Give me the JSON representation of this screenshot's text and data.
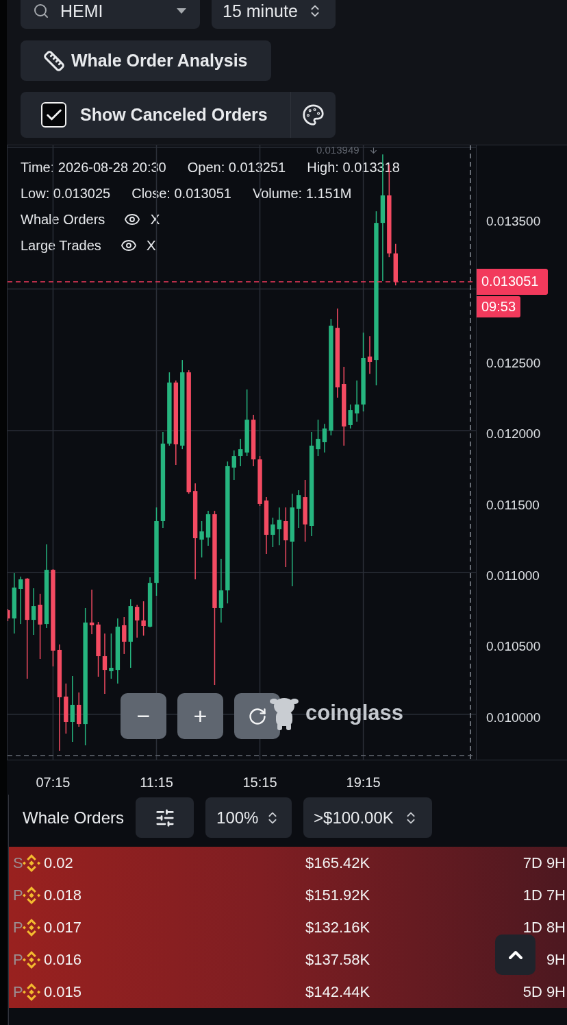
{
  "symbol_select": {
    "value": "HEMI"
  },
  "interval_select": {
    "value": "15 minute"
  },
  "analysis_button": {
    "label": "Whale Order Analysis"
  },
  "canceled_toggle": {
    "label": "Show Canceled Orders",
    "checked": true
  },
  "chart": {
    "high_marker": "0.013949",
    "ohlc_rows": [
      [
        "Time: 2026-08-28 20:30",
        "Open: 0.013251",
        "High: 0.013318"
      ],
      [
        "Low: 0.013025",
        "Close: 0.013051",
        "Volume: 1.151M"
      ]
    ],
    "layers": [
      {
        "name": "Whale Orders",
        "visible": true,
        "remove": "X"
      },
      {
        "name": "Large Trades",
        "visible": true,
        "remove": "X"
      }
    ],
    "current_price": {
      "price": "0.013051",
      "countdown": "09:53"
    },
    "zoom_controls": {
      "zoom_out": "−",
      "zoom_in": "+"
    },
    "logo_text": "coinglass",
    "chart_data": {
      "type": "candlestick",
      "grid": true,
      "x": [
        5.5,
        5.75,
        6,
        6.25,
        6.5,
        6.75,
        7,
        7.25,
        7.5,
        7.75,
        8,
        8.25,
        8.5,
        8.75,
        9,
        9.25,
        9.5,
        9.75,
        10,
        10.25,
        10.5,
        10.75,
        11,
        11.25,
        11.5,
        11.75,
        12,
        12.25,
        12.5,
        12.75,
        13,
        13.25,
        13.5,
        13.75,
        14,
        14.25,
        14.5,
        14.75,
        15,
        15.25,
        15.5,
        15.75,
        16,
        16.25,
        16.5,
        16.75,
        17,
        17.25,
        17.5,
        17.75,
        18,
        18.25,
        18.5,
        18.75,
        19,
        19.25,
        19.5,
        19.75,
        20,
        20.25,
        20.5
      ],
      "ohlc": [
        [
          0.010734,
          0.010744,
          0.010657,
          0.010676
        ],
        [
          0.010676,
          0.010995,
          0.01057,
          0.010894
        ],
        [
          0.010884,
          0.010971,
          0.010637,
          0.010952
        ],
        [
          0.010957,
          0.010961,
          0.010251,
          0.010666
        ],
        [
          0.010666,
          0.010889,
          0.01056,
          0.010763
        ],
        [
          0.010773,
          0.01085,
          0.010391,
          0.010633
        ],
        [
          0.010637,
          0.011198,
          0.010608,
          0.011019
        ],
        [
          0.011019,
          0.011024,
          0.010338,
          0.010449
        ],
        [
          0.010454,
          0.010492,
          0.009743,
          0.01012
        ],
        [
          0.010125,
          0.010217,
          0.009864,
          0.009946
        ],
        [
          0.009946,
          0.01027,
          0.009806,
          0.010067
        ],
        [
          0.010067,
          0.010154,
          0.009912,
          0.009931
        ],
        [
          0.009931,
          0.010749,
          0.009781,
          0.010647
        ],
        [
          0.010647,
          0.010879,
          0.010565,
          0.010628
        ],
        [
          0.010633,
          0.010652,
          0.010265,
          0.01041
        ],
        [
          0.01041,
          0.01057,
          0.010144,
          0.010313
        ],
        [
          0.010304,
          0.01057,
          0.010251,
          0.010328
        ],
        [
          0.010313,
          0.010676,
          0.010217,
          0.010618
        ],
        [
          0.010628,
          0.010686,
          0.010425,
          0.010512
        ],
        [
          0.010512,
          0.010811,
          0.010328,
          0.010763
        ],
        [
          0.010758,
          0.010773,
          0.010541,
          0.010662
        ],
        [
          0.010662,
          0.010797,
          0.010555,
          0.010623
        ],
        [
          0.010618,
          0.010966,
          0.010613,
          0.010927
        ],
        [
          0.010927,
          0.011459,
          0.010836,
          0.011363
        ],
        [
          0.011363,
          0.011991,
          0.011314,
          0.011909
        ],
        [
          0.011909,
          0.012412,
          0.011895,
          0.01234
        ],
        [
          0.01234,
          0.012354,
          0.011759,
          0.011904
        ],
        [
          0.011895,
          0.012499,
          0.01187,
          0.012412
        ],
        [
          0.012412,
          0.012427,
          0.011556,
          0.011566
        ],
        [
          0.011575,
          0.011629,
          0.010952,
          0.011242
        ],
        [
          0.011232,
          0.011363,
          0.011106,
          0.01129
        ],
        [
          0.011247,
          0.011435,
          0.011189,
          0.011411
        ],
        [
          0.011411,
          0.011435,
          0.010207,
          0.010749
        ],
        [
          0.010749,
          0.011097,
          0.010647,
          0.010874
        ],
        [
          0.010874,
          0.011783,
          0.010782,
          0.01175
        ],
        [
          0.01174,
          0.011861,
          0.011653,
          0.011822
        ],
        [
          0.011822,
          0.011943,
          0.01175,
          0.01187
        ],
        [
          0.011846,
          0.012291,
          0.011822,
          0.012078
        ],
        [
          0.012078,
          0.012112,
          0.01175,
          0.011798
        ],
        [
          0.011798,
          0.011822,
          0.011469,
          0.011484
        ],
        [
          0.011508,
          0.011532,
          0.011131,
          0.011266
        ],
        [
          0.011266,
          0.011387,
          0.011179,
          0.011339
        ],
        [
          0.011305,
          0.011459,
          0.011193,
          0.011372
        ],
        [
          0.011363,
          0.011459,
          0.011039,
          0.011227
        ],
        [
          0.011218,
          0.011556,
          0.010903,
          0.011459
        ],
        [
          0.01145,
          0.01158,
          0.011314,
          0.011546
        ],
        [
          0.011532,
          0.011653,
          0.011218,
          0.011339
        ],
        [
          0.011329,
          0.011991,
          0.011256,
          0.011895
        ],
        [
          0.01187,
          0.012078,
          0.011822,
          0.011943
        ],
        [
          0.011919,
          0.012049,
          0.011846,
          0.012016
        ],
        [
          0.012001,
          0.012789,
          0.011967,
          0.012741
        ],
        [
          0.012726,
          0.012862,
          0.012233,
          0.012306
        ],
        [
          0.01233,
          0.012451,
          0.011895,
          0.01203
        ],
        [
          0.01204,
          0.012185,
          0.012016,
          0.012146
        ],
        [
          0.012122,
          0.012354,
          0.012064,
          0.012185
        ],
        [
          0.012185,
          0.012692,
          0.012136,
          0.012514
        ],
        [
          0.012523,
          0.012668,
          0.012402,
          0.012485
        ],
        [
          0.012499,
          0.013548,
          0.01232,
          0.013466
        ],
        [
          0.013466,
          0.013949,
          0.013055,
          0.01366
        ],
        [
          0.01366,
          0.013877,
          0.013224,
          0.013251
        ],
        [
          0.013251,
          0.013318,
          0.013025,
          0.013051
        ]
      ],
      "xlim": [
        5.49,
        27.127
      ],
      "ylim": [
        0.00968,
        0.014013
      ],
      "xticks": [
        {
          "value": 7.25,
          "label": "07:15"
        },
        {
          "value": 11.25,
          "label": "11:15"
        },
        {
          "value": 15.25,
          "label": "15:15"
        },
        {
          "value": 19.25,
          "label": "19:15"
        }
      ],
      "yticks": [
        {
          "value": 0.0135,
          "label": "0.013500"
        },
        {
          "value": 0.0125,
          "label": "0.012500"
        },
        {
          "value": 0.012,
          "label": "0.012000"
        },
        {
          "value": 0.0115,
          "label": "0.011500"
        },
        {
          "value": 0.011,
          "label": "0.011000"
        },
        {
          "value": 0.0105,
          "label": "0.010500"
        },
        {
          "value": 0.01,
          "label": "0.010000"
        }
      ],
      "ref_lines": [
        {
          "axis": "x",
          "value": 23.39,
          "color": "#8a8f98"
        },
        {
          "axis": "y",
          "value": 0.009709,
          "color": "#656b74"
        },
        {
          "axis": "y",
          "value": 0.013051,
          "color": "#f23a5c"
        }
      ]
    }
  },
  "whale_orders": {
    "title": "Whale Orders",
    "ratio_select": "100%",
    "min_value_select": ">$100.00K",
    "rows": [
      {
        "column_1": "S",
        "column_2": "0.02",
        "column_3": "$165.42K",
        "column_4": "7D 9H"
      },
      {
        "column_1": "P",
        "column_2": "0.018",
        "column_3": "$151.92K",
        "column_4": "1D 7H"
      },
      {
        "column_1": "P",
        "column_2": "0.017",
        "column_3": "$132.16K",
        "column_4": "1D 8H"
      },
      {
        "column_1": "P",
        "column_2": "0.016",
        "column_3": "$137.58K",
        "column_4": "9H"
      },
      {
        "column_1": "P",
        "column_2": "0.015",
        "column_3": "$142.44K",
        "column_4": "5D 9H"
      }
    ]
  }
}
